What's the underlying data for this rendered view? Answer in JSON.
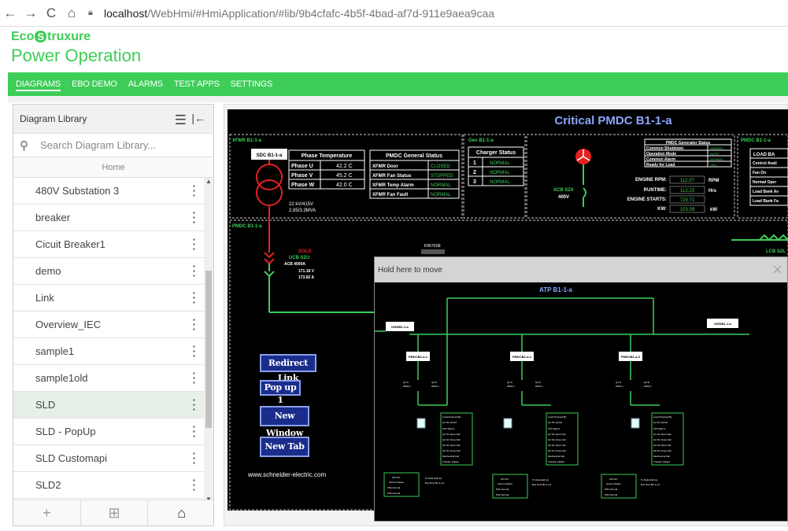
{
  "browser": {
    "back": "←",
    "forward": "→",
    "reload": "C",
    "home": "⌂",
    "url_host": "localhost",
    "url_path": "/WebHmi/#HmiApplication/#lib/9b4cfafc-4b5f-4bad-af7d-911e9aea9caa"
  },
  "brand": {
    "logo_prefix": "Eco",
    "logo_mid": "S",
    "logo_suffix": "truxure",
    "app_name": "Power Operation"
  },
  "menu": [
    "DIAGRAMS",
    "EBO DEMO",
    "ALARMS",
    "TEST APPS",
    "SETTINGS"
  ],
  "library": {
    "title": "Diagram Library",
    "search_placeholder": "Search Diagram Library...",
    "home": "Home",
    "items": [
      "480V Substation 3",
      "breaker",
      "Cicuit Breaker1",
      "demo",
      "Link",
      "Overview_IEC",
      "sample1",
      "sample1old",
      "SLD",
      "SLD - PopUp",
      "SLD Customapi",
      "SLD2"
    ],
    "selected": "SLD",
    "footer": [
      "+",
      "⊞",
      "⌂"
    ]
  },
  "diagram": {
    "title": "Critical PMDC B1-1-a",
    "xfmr_label": "XFMR B1-1-a",
    "gen_label": "Gen B1-1-a",
    "pmdc_label": "PMDC B1-1-a",
    "pmdc_label2": "PMDC B1-1-a",
    "sdc_tag": "SDC B1-1-a",
    "phase_temp": {
      "title": "Phase Temperature",
      "rows": [
        [
          "Phase U",
          "42.2 C"
        ],
        [
          "Phase V",
          "45.2 C"
        ],
        [
          "Phase W",
          "42.0 C"
        ]
      ]
    },
    "xfmr_rating": [
      "22 kV/415V",
      "2.85/3.3MVA"
    ],
    "general_status": {
      "title": "PMDC General Status",
      "rows": [
        [
          "XFMR Door",
          "CLOSED"
        ],
        [
          "XFMR Fan Status",
          "STOPPED"
        ],
        [
          "XFMR Temp Alarm",
          "NORMAL"
        ],
        [
          "XFMR Fan Fault",
          "NORMAL"
        ]
      ]
    },
    "charger": {
      "title": "Charger Status",
      "rows": [
        [
          "1",
          "NORMAL"
        ],
        [
          "2",
          "NORMAL"
        ],
        [
          "3",
          "NORMAL"
        ]
      ]
    },
    "xcb_tag": "XCB S2X",
    "xcb_voltage": "400V",
    "gen_status": {
      "title": "PMDC Generator Status",
      "rows": [
        [
          "Common Shutdown",
          "NORMAL"
        ],
        [
          "Operation Mode",
          "AUTO"
        ],
        [
          "Common Alarm",
          "NORMAL"
        ],
        [
          "Ready for Load",
          "YES"
        ]
      ]
    },
    "engine": [
      [
        "ENGINE RPM:",
        "112.07",
        "RPM"
      ],
      [
        "RUNTIME:",
        "113.23",
        "Hrs"
      ],
      [
        "ENGINE STARTS:",
        "729.71",
        ""
      ],
      [
        "KW:",
        "103.09",
        "kW"
      ]
    ],
    "load_bank": {
      "title": "LOAD BA",
      "rows": [
        "Control Avail",
        "Fan On",
        "Normal Oper",
        "Load Bank Av",
        "Load Bank Fa"
      ]
    },
    "ucb": {
      "status": "SOLD",
      "tag": "UCB S2U",
      "rating": "ACB 4000A",
      "v": "171.18 V",
      "a": "173.82 A"
    },
    "buttons": [
      "Redirect Link",
      "Pop up 1",
      "New Window",
      "New Tab"
    ],
    "website": "www.schneider-electric.com",
    "lcb_tag": "LCB S2L",
    "k_tag": "K9670S8"
  },
  "popup": {
    "header": "Hold here to move",
    "close": "×",
    "title": "ATP B1-1-a",
    "top_left_tag": "ISSDB1-1-a",
    "top_right_tag": "ISSDB1-1-a",
    "bus_tags": [
      "PMDCB1-a-1",
      "PMDCB1-a-2",
      "PMDCB1-a-3"
    ],
    "breakers": [
      [
        "Q1 N",
        "2000 A"
      ],
      [
        "Q2 E",
        "2000 A"
      ]
    ],
    "load_powered": [
      "Load Powered By",
      "Q1 N1  Q2 E2",
      "ATP Alarms",
      "Q1 S1 Open Fail",
      "Q1 S1 Close Fail",
      "Q2 S1 Open Fail",
      "Q2 S1 Close Fail",
      "Mechanical Fail",
      "Transfer Failure"
    ],
    "source_status": [
      "24V DC",
      "Source Status",
      "PS1  Normal",
      "PS2  Normal"
    ],
    "to_data_hall": [
      "To Data Hall via",
      "Bus Duct B1-1-a-1"
    ]
  }
}
